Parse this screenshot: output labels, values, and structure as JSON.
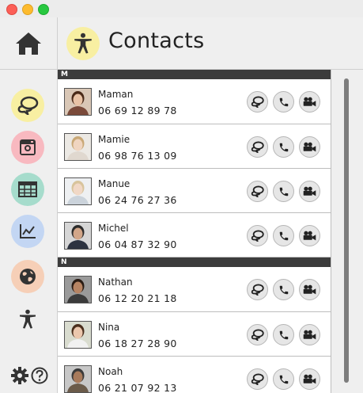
{
  "window": {
    "controls": [
      "close",
      "minimize",
      "maximize"
    ]
  },
  "header": {
    "title": "Contacts",
    "icon": "person-icon"
  },
  "sidebar": {
    "items": [
      {
        "name": "messages",
        "icon": "chat-bubbles-icon",
        "color": "#f8efa2"
      },
      {
        "name": "instagram",
        "icon": "instagram-icon",
        "color": "#f8b9c0"
      },
      {
        "name": "calendar",
        "icon": "grid-table-icon",
        "color": "#a6dccc"
      },
      {
        "name": "stats",
        "icon": "line-chart-icon",
        "color": "#c3d6f3"
      },
      {
        "name": "web",
        "icon": "globe-icon",
        "color": "#f6cfb7"
      },
      {
        "name": "accessibility",
        "icon": "person-icon",
        "color": ""
      }
    ],
    "bottom": [
      "gear-icon",
      "help-icon"
    ]
  },
  "contacts": {
    "sections": [
      {
        "letter": "M",
        "items": [
          {
            "name": "Maman",
            "phone": "06 69 12 89 78"
          },
          {
            "name": "Mamie",
            "phone": "06 98 76 13 09"
          },
          {
            "name": "Manue",
            "phone": "06 24 76 27 36"
          },
          {
            "name": "Michel",
            "phone": "06 04 87 32 90"
          }
        ]
      },
      {
        "letter": "N",
        "items": [
          {
            "name": "Nathan",
            "phone": "06 12 20 21 18"
          },
          {
            "name": "Nina",
            "phone": "06 18 27 28 90"
          },
          {
            "name": "Noah",
            "phone": "06 21 07 92 13"
          }
        ]
      }
    ]
  }
}
